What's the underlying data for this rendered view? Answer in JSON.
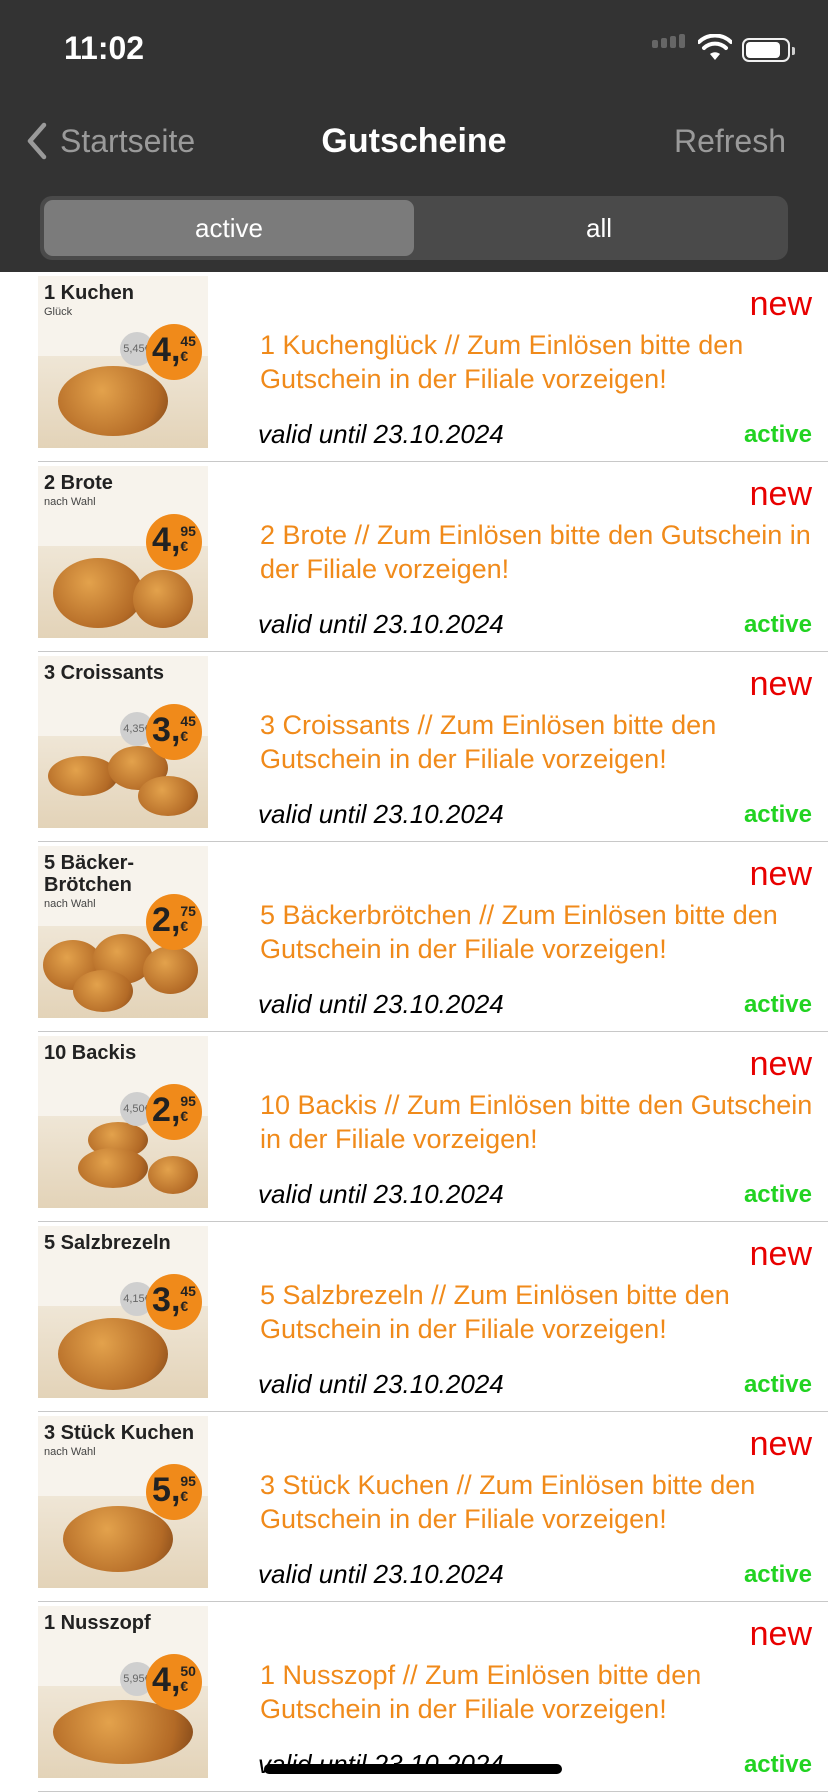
{
  "status_bar": {
    "time": "11:02",
    "icons": [
      "cellular-signal-icon",
      "wifi-icon",
      "battery-icon"
    ]
  },
  "nav": {
    "back_label": "Startseite",
    "title": "Gutscheine",
    "refresh_label": "Refresh"
  },
  "segmented": {
    "options": [
      "active",
      "all"
    ],
    "selected": "active"
  },
  "colors": {
    "header_bg": "#333333",
    "description": "#f08a1a",
    "new_label": "#e80000",
    "active_label": "#21d321"
  },
  "coupons": [
    {
      "thumb_title": "1 Kuchen",
      "thumb_sub": "Glück",
      "price_main": "4,",
      "price_cents": "45",
      "price_currency": "€",
      "old_price": "5,45€",
      "new_label": "new",
      "description": "1 Kuchenglück // Zum Einlösen bitte den Gutschein in der Filiale vorzeigen!",
      "valid": "valid until 23.10.2024",
      "status": "active"
    },
    {
      "thumb_title": "2 Brote",
      "thumb_sub": "nach Wahl",
      "price_main": "4,",
      "price_cents": "95",
      "price_currency": "€",
      "old_price": "",
      "new_label": "new",
      "description": "2 Brote // Zum Einlösen bitte den Gutschein in der Filiale vorzeigen!",
      "valid": "valid until 23.10.2024",
      "status": "active"
    },
    {
      "thumb_title": "3 Croissants",
      "thumb_sub": "",
      "price_main": "3,",
      "price_cents": "45",
      "price_currency": "€",
      "old_price": "4,35€",
      "new_label": "new",
      "description": "3 Croissants // Zum Einlösen bitte den Gutschein in der Filiale vorzeigen!",
      "valid": "valid until 23.10.2024",
      "status": "active"
    },
    {
      "thumb_title": "5 Bäcker-\nBrötchen",
      "thumb_sub": "nach Wahl",
      "price_main": "2,",
      "price_cents": "75",
      "price_currency": "€",
      "old_price": "",
      "new_label": "new",
      "description": "5 Bäckerbrötchen // Zum Einlösen bitte den Gutschein in der Filiale vorzeigen!",
      "valid": "valid until 23.10.2024",
      "status": "active"
    },
    {
      "thumb_title": "10 Backis",
      "thumb_sub": "",
      "price_main": "2,",
      "price_cents": "95",
      "price_currency": "€",
      "old_price": "4,50€",
      "new_label": "new",
      "description": "10 Backis // Zum Einlösen bitte den Gutschein in der Filiale vorzeigen!",
      "valid": "valid until 23.10.2024",
      "status": "active"
    },
    {
      "thumb_title": "5 Salzbrezeln",
      "thumb_sub": "",
      "price_main": "3,",
      "price_cents": "45",
      "price_currency": "€",
      "old_price": "4,15€",
      "new_label": "new",
      "description": "5 Salzbrezeln // Zum Einlösen bitte den Gutschein in der Filiale vorzeigen!",
      "valid": "valid until 23.10.2024",
      "status": "active"
    },
    {
      "thumb_title": "3 Stück Kuchen",
      "thumb_sub": "nach Wahl",
      "price_main": "5,",
      "price_cents": "95",
      "price_currency": "€",
      "old_price": "",
      "new_label": "new",
      "description": "3 Stück Kuchen // Zum Einlösen bitte den Gutschein in der Filiale vorzeigen!",
      "valid": "valid until 23.10.2024",
      "status": "active"
    },
    {
      "thumb_title": "1 Nusszopf",
      "thumb_sub": "",
      "price_main": "4,",
      "price_cents": "50",
      "price_currency": "€",
      "old_price": "5,95€",
      "new_label": "new",
      "description": "1 Nusszopf // Zum Einlösen bitte den Gutschein in der Filiale vorzeigen!",
      "valid": "valid until 23.10.2024",
      "status": "active"
    }
  ]
}
